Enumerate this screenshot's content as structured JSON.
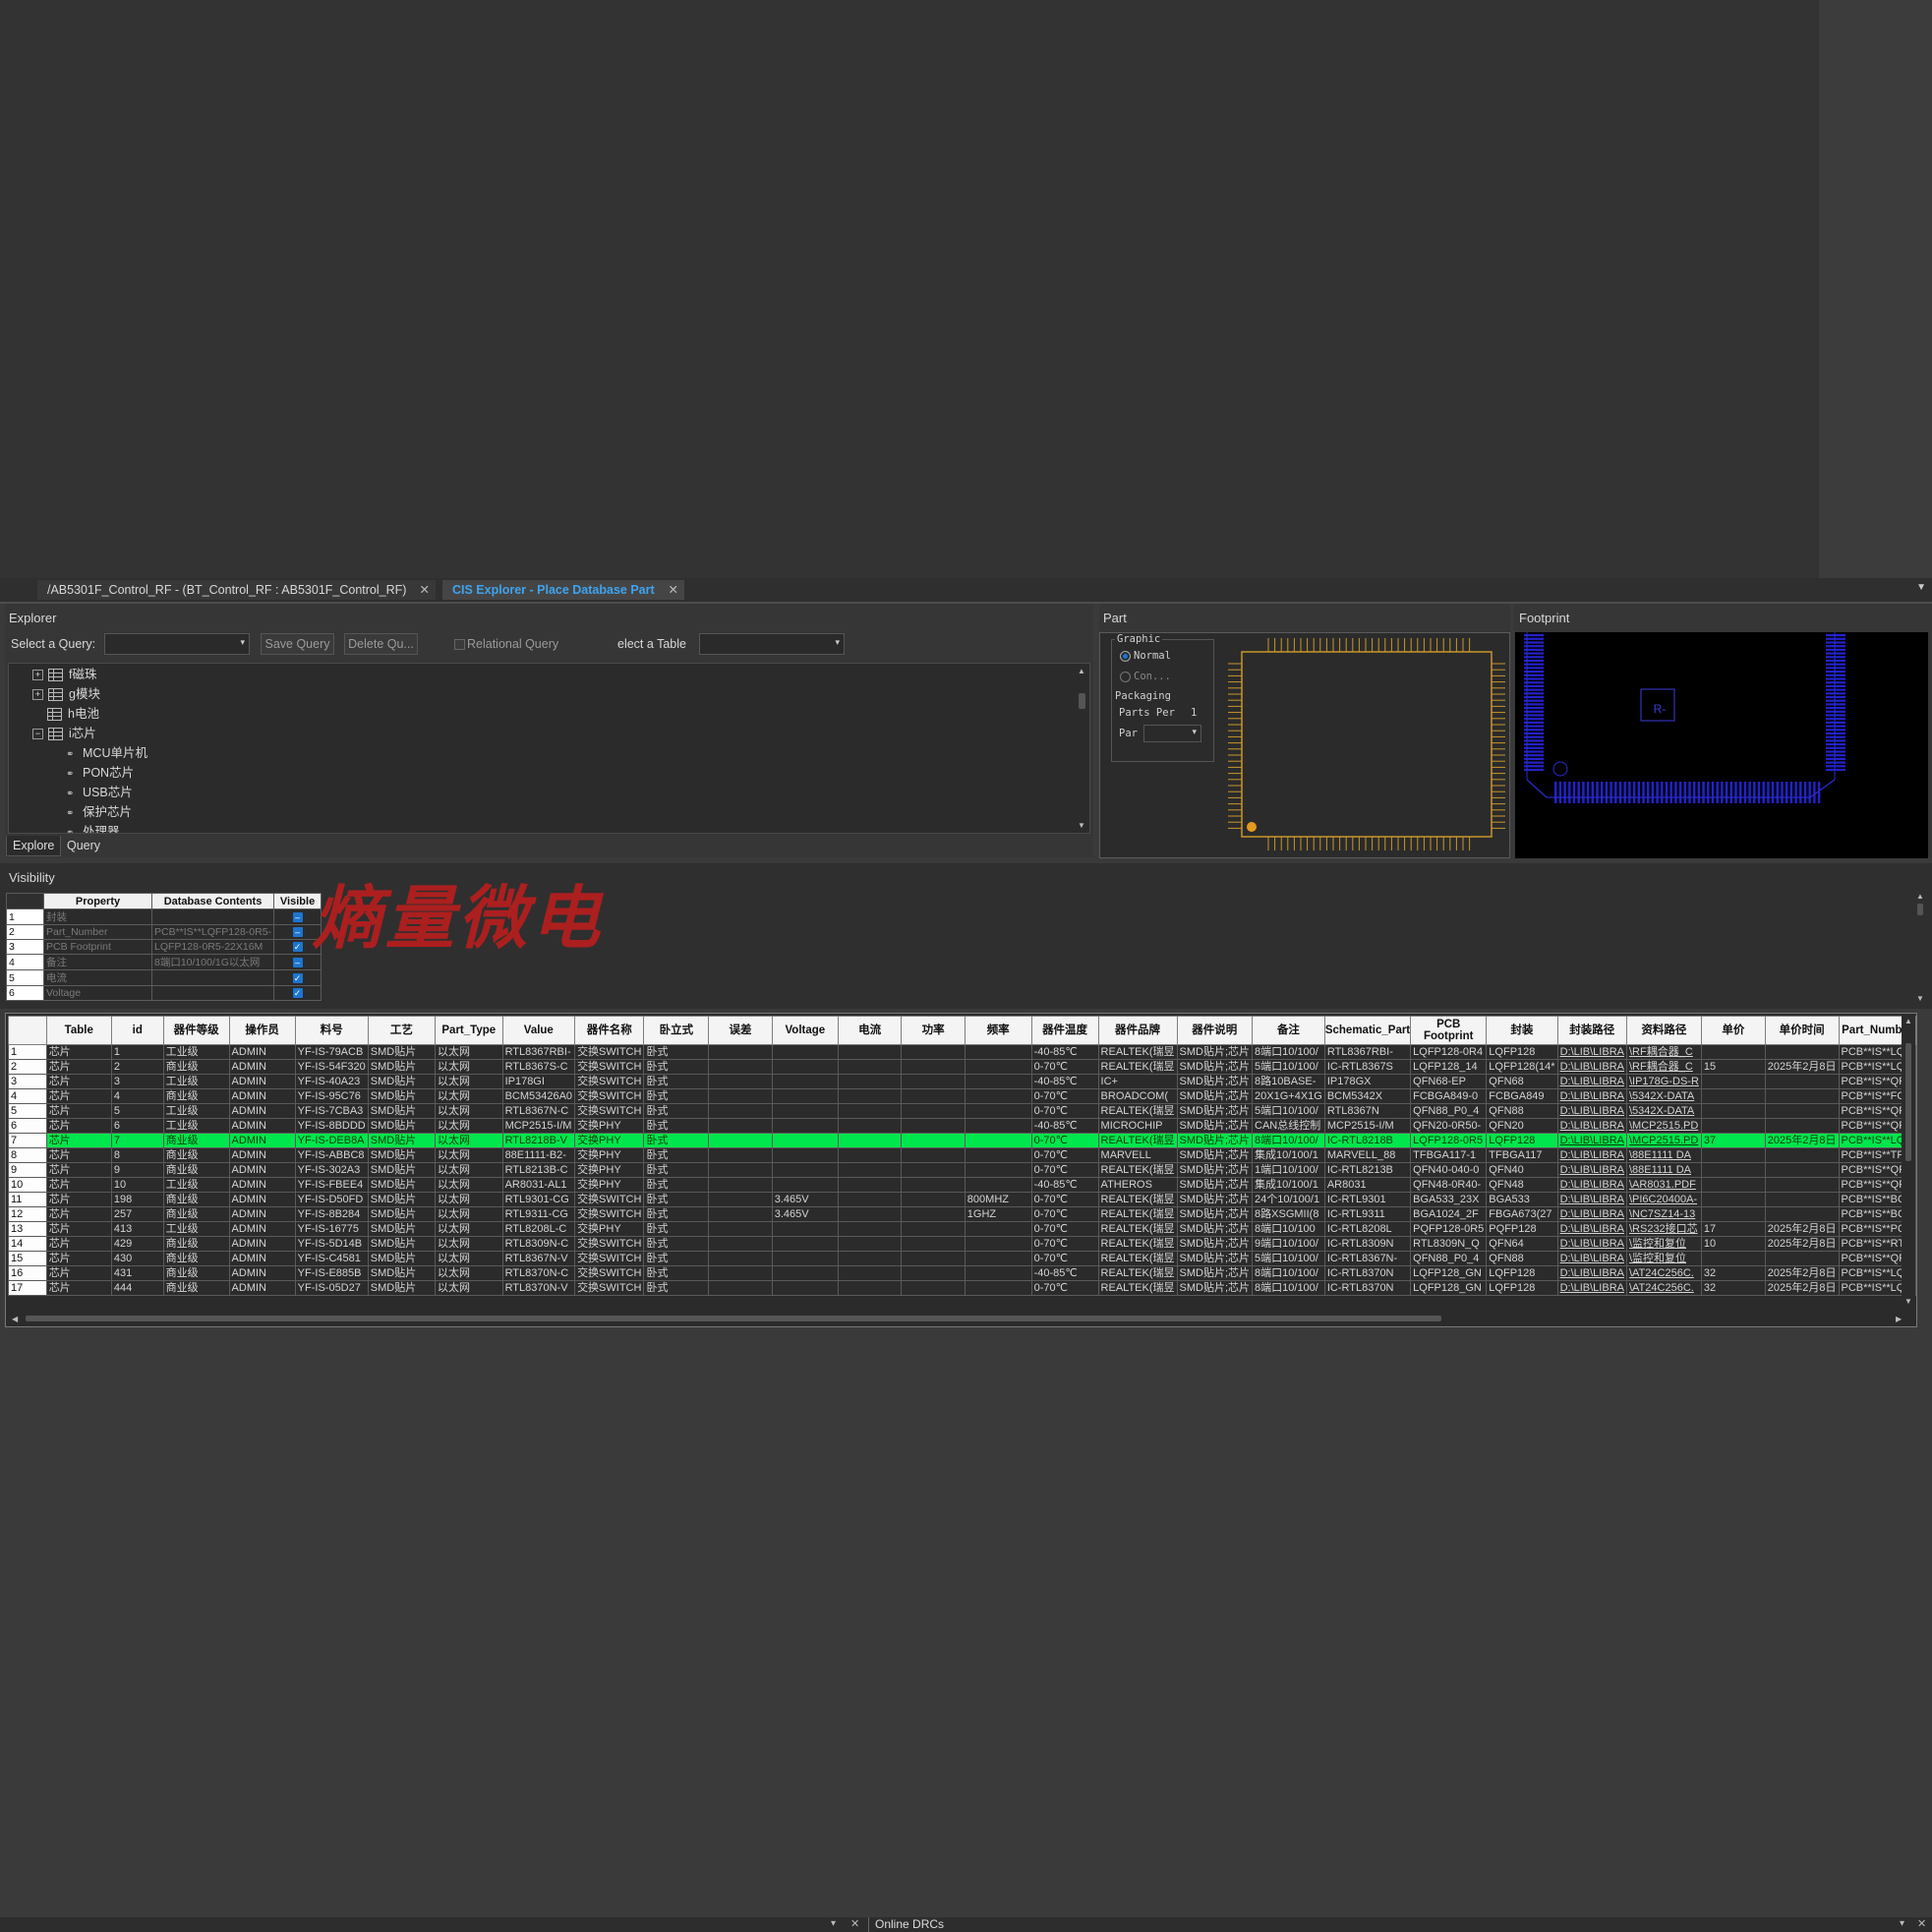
{
  "tabs": [
    {
      "label": "/AB5301F_Control_RF - (BT_Control_RF : AB5301F_Control_RF)",
      "close": "✕"
    },
    {
      "label": "CIS Explorer - Place Database Part",
      "close": "✕"
    }
  ],
  "explorer": {
    "title": "Explorer",
    "select_query_label": "Select a Query:",
    "save_query": "Save Query",
    "delete_query": "Delete Qu...",
    "relational_query": "Relational Query",
    "select_table_label": "elect a Table",
    "tree": [
      {
        "label": "f磁珠",
        "expander": "+"
      },
      {
        "label": "g模块",
        "expander": "+"
      },
      {
        "label": "h电池",
        "expander": ""
      },
      {
        "label": "i芯片",
        "expander": "−"
      },
      {
        "label": "MCU单片机"
      },
      {
        "label": "PON芯片"
      },
      {
        "label": "USB芯片"
      },
      {
        "label": "保护芯片"
      },
      {
        "label": "处理器"
      }
    ],
    "subtabs": [
      "Explore",
      "Query"
    ]
  },
  "part": {
    "title": "Part",
    "graphic_label": "Graphic",
    "normal_label": "Normal",
    "convert_label": "Con...",
    "packaging_label": "Packaging",
    "parts_per_label": "Parts Per",
    "parts_per_value": "1",
    "part_label": "Par",
    "pin1_color": "#e39a1e",
    "body_color": "#c9962a"
  },
  "footprint": {
    "title": "Footprint",
    "refdes": "R-",
    "pad_color": "#2222cc"
  },
  "visibility": {
    "title": "Visibility",
    "headers": [
      "Property",
      "Database Contents",
      "Visible"
    ],
    "rows": [
      {
        "n": "1",
        "property": "封装",
        "contents": "",
        "visible": false
      },
      {
        "n": "2",
        "property": "Part_Number",
        "contents": "PCB**IS**LQFP128-0R5-",
        "visible": false
      },
      {
        "n": "3",
        "property": "PCB Footprint",
        "contents": "LQFP128-0R5-22X16M",
        "visible": true
      },
      {
        "n": "4",
        "property": "备注",
        "contents": "8端口10/100/1G以太网",
        "visible": false
      },
      {
        "n": "5",
        "property": "电流",
        "contents": "",
        "visible": true
      },
      {
        "n": "6",
        "property": "Voltage",
        "contents": "",
        "visible": true
      }
    ],
    "watermark": "熵量微电"
  },
  "grid": {
    "headers": [
      "Table",
      "id",
      "器件等级",
      "操作员",
      "料号",
      "工艺",
      "Part_Type",
      "Value",
      "器件名称",
      "卧立式",
      "误差",
      "Voltage",
      "电流",
      "功率",
      "频率",
      "器件温度",
      "器件品牌",
      "器件说明",
      "备注",
      "Schematic_Part",
      "PCB Footprint",
      "封装",
      "封装路径",
      "资料路径",
      "单价",
      "单价时间",
      "Part_Number"
    ],
    "selected_row": "7",
    "rows": [
      [
        "1",
        "芯片",
        "1",
        "工业级",
        "ADMIN",
        "YF-IS-79ACB",
        "SMD贴片",
        "以太网",
        "RTL8367RBI-",
        "交换SWITCH",
        "卧式",
        "",
        "",
        "",
        "",
        "",
        "-40-85℃",
        "REALTEK(瑞昱",
        "SMD贴片;芯片",
        "8端口10/100/",
        "RTL8367RBI-",
        "LQFP128-0R4",
        "LQFP128",
        "D:\\LIB\\LIBRA",
        "\\RF耦合器_C",
        "",
        "",
        "PCB**IS**LQF"
      ],
      [
        "2",
        "芯片",
        "2",
        "商业级",
        "ADMIN",
        "YF-IS-54F320",
        "SMD贴片",
        "以太网",
        "RTL8367S-C",
        "交换SWITCH",
        "卧式",
        "",
        "",
        "",
        "",
        "",
        "0-70℃",
        "REALTEK(瑞昱",
        "SMD贴片;芯片",
        "5端口10/100/",
        "IC-RTL8367S",
        "LQFP128_14",
        "LQFP128(14*",
        "D:\\LIB\\LIBRA",
        "\\RF耦合器_C",
        "15",
        "2025年2月8日",
        "PCB**IS**LQF"
      ],
      [
        "3",
        "芯片",
        "3",
        "工业级",
        "ADMIN",
        "YF-IS-40A23",
        "SMD贴片",
        "以太网",
        "IP178GI",
        "交换SWITCH",
        "卧式",
        "",
        "",
        "",
        "",
        "",
        "-40-85℃",
        "IC+",
        "SMD贴片;芯片",
        "8路10BASE-",
        "IP178GX",
        "QFN68-EP",
        "QFN68",
        "D:\\LIB\\LIBRA",
        "\\IP178G-DS-R",
        "",
        "",
        "PCB**IS**QFN"
      ],
      [
        "4",
        "芯片",
        "4",
        "商业级",
        "ADMIN",
        "YF-IS-95C76",
        "SMD贴片",
        "以太网",
        "BCM53426A0",
        "交换SWITCH",
        "卧式",
        "",
        "",
        "",
        "",
        "",
        "0-70℃",
        "BROADCOM(",
        "SMD贴片;芯片",
        "20X1G+4X1G",
        "BCM5342X",
        "FCBGA849-0",
        "FCBGA849",
        "D:\\LIB\\LIBRA",
        "\\5342X-DATA",
        "",
        "",
        "PCB**IS**FCB"
      ],
      [
        "5",
        "芯片",
        "5",
        "工业级",
        "ADMIN",
        "YF-IS-7CBA3",
        "SMD贴片",
        "以太网",
        "RTL8367N-C",
        "交换SWITCH",
        "卧式",
        "",
        "",
        "",
        "",
        "",
        "0-70℃",
        "REALTEK(瑞昱",
        "SMD贴片;芯片",
        "5端口10/100/",
        "RTL8367N",
        "QFN88_P0_4",
        "QFN88",
        "D:\\LIB\\LIBRA",
        "\\5342X-DATA",
        "",
        "",
        "PCB**IS**QFN"
      ],
      [
        "6",
        "芯片",
        "6",
        "工业级",
        "ADMIN",
        "YF-IS-8BDDD",
        "SMD贴片",
        "以太网",
        "MCP2515-I/M",
        "交换PHY",
        "卧式",
        "",
        "",
        "",
        "",
        "",
        "-40-85℃",
        "MICROCHIP",
        "SMD贴片;芯片",
        "CAN总线控制",
        "MCP2515-I/M",
        "QFN20-0R50-",
        "QFN20",
        "D:\\LIB\\LIBRA",
        "\\MCP2515.PD",
        "",
        "",
        "PCB**IS**QFN"
      ],
      [
        "7",
        "芯片",
        "7",
        "商业级",
        "ADMIN",
        "YF-IS-DEB8A",
        "SMD贴片",
        "以太网",
        "RTL8218B-V",
        "交换PHY",
        "卧式",
        "",
        "",
        "",
        "",
        "",
        "0-70℃",
        "REALTEK(瑞昱",
        "SMD贴片;芯片",
        "8端口10/100/",
        "IC-RTL8218B",
        "LQFP128-0R5",
        "LQFP128",
        "D:\\LIB\\LIBRA",
        "\\MCP2515.PD",
        "37",
        "2025年2月8日",
        "PCB**IS**LQF"
      ],
      [
        "8",
        "芯片",
        "8",
        "商业级",
        "ADMIN",
        "YF-IS-ABBC8",
        "SMD贴片",
        "以太网",
        "88E1111-B2-",
        "交换PHY",
        "卧式",
        "",
        "",
        "",
        "",
        "",
        "0-70℃",
        "MARVELL",
        "SMD贴片;芯片",
        "集成10/100/1",
        "MARVELL_88",
        "TFBGA117-1",
        "TFBGA117",
        "D:\\LIB\\LIBRA",
        "\\88E1111 DA",
        "",
        "",
        "PCB**IS**TFB"
      ],
      [
        "9",
        "芯片",
        "9",
        "商业级",
        "ADMIN",
        "YF-IS-302A3",
        "SMD贴片",
        "以太网",
        "RTL8213B-C",
        "交换PHY",
        "卧式",
        "",
        "",
        "",
        "",
        "",
        "0-70℃",
        "REALTEK(瑞昱",
        "SMD贴片;芯片",
        "1端口10/100/",
        "IC-RTL8213B",
        "QFN40-040-0",
        "QFN40",
        "D:\\LIB\\LIBRA",
        "\\88E1111 DA",
        "",
        "",
        "PCB**IS**QFN"
      ],
      [
        "10",
        "芯片",
        "10",
        "工业级",
        "ADMIN",
        "YF-IS-FBEE4",
        "SMD贴片",
        "以太网",
        "AR8031-AL1",
        "交换PHY",
        "卧式",
        "",
        "",
        "",
        "",
        "",
        "-40-85℃",
        "ATHEROS",
        "SMD贴片;芯片",
        "集成10/100/1",
        "AR8031",
        "QFN48-0R40-",
        "QFN48",
        "D:\\LIB\\LIBRA",
        "\\AR8031.PDF",
        "",
        "",
        "PCB**IS**QFN"
      ],
      [
        "11",
        "芯片",
        "198",
        "商业级",
        "ADMIN",
        "YF-IS-D50FD",
        "SMD贴片",
        "以太网",
        "RTL9301-CG",
        "交换SWITCH",
        "卧式",
        "",
        "3.465V",
        "",
        "",
        "800MHZ",
        "0-70℃",
        "REALTEK(瑞昱",
        "SMD贴片;芯片",
        "24个10/100/1",
        "IC-RTL9301",
        "BGA533_23X",
        "BGA533",
        "D:\\LIB\\LIBRA",
        "\\PI6C20400A-",
        "",
        "",
        "PCB**IS**BG"
      ],
      [
        "12",
        "芯片",
        "257",
        "商业级",
        "ADMIN",
        "YF-IS-8B284",
        "SMD贴片",
        "以太网",
        "RTL9311-CG",
        "交换SWITCH",
        "卧式",
        "",
        "3.465V",
        "",
        "",
        "1GHZ",
        "0-70℃",
        "REALTEK(瑞昱",
        "SMD贴片;芯片",
        "8路XSGMII(8",
        "IC-RTL9311",
        "BGA1024_2F",
        "FBGA673(27",
        "D:\\LIB\\LIBRA",
        "\\NC7SZ14-13",
        "",
        "",
        "PCB**IS**BG"
      ],
      [
        "13",
        "芯片",
        "413",
        "工业级",
        "ADMIN",
        "YF-IS-16775",
        "SMD贴片",
        "以太网",
        "RTL8208L-C",
        "交换PHY",
        "卧式",
        "",
        "",
        "",
        "",
        "",
        "0-70℃",
        "REALTEK(瑞昱",
        "SMD贴片;芯片",
        "8端口10/100",
        "IC-RTL8208L",
        "PQFP128-0R5",
        "PQFP128",
        "D:\\LIB\\LIBRA",
        "\\RS232接口芯",
        "17",
        "2025年2月8日",
        "PCB**IS**PQF"
      ],
      [
        "14",
        "芯片",
        "429",
        "商业级",
        "ADMIN",
        "YF-IS-5D14B",
        "SMD贴片",
        "以太网",
        "RTL8309N-C",
        "交换SWITCH",
        "卧式",
        "",
        "",
        "",
        "",
        "",
        "0-70℃",
        "REALTEK(瑞昱",
        "SMD贴片;芯片",
        "9端口10/100/",
        "IC-RTL8309N",
        "RTL8309N_Q",
        "QFN64",
        "D:\\LIB\\LIBRA",
        "\\监控和复位",
        "10",
        "2025年2月8日",
        "PCB**IS**RTL"
      ],
      [
        "15",
        "芯片",
        "430",
        "商业级",
        "ADMIN",
        "YF-IS-C4581",
        "SMD贴片",
        "以太网",
        "RTL8367N-V",
        "交换SWITCH",
        "卧式",
        "",
        "",
        "",
        "",
        "",
        "0-70℃",
        "REALTEK(瑞昱",
        "SMD贴片;芯片",
        "5端口10/100/",
        "IC-RTL8367N-",
        "QFN88_P0_4",
        "QFN88",
        "D:\\LIB\\LIBRA",
        "\\监控和复位",
        "",
        "",
        "PCB**IS**QFN"
      ],
      [
        "16",
        "芯片",
        "431",
        "商业级",
        "ADMIN",
        "YF-IS-E885B",
        "SMD贴片",
        "以太网",
        "RTL8370N-C",
        "交换SWITCH",
        "卧式",
        "",
        "",
        "",
        "",
        "",
        "-40-85℃",
        "REALTEK(瑞昱",
        "SMD贴片;芯片",
        "8端口10/100/",
        "IC-RTL8370N",
        "LQFP128_GN",
        "LQFP128",
        "D:\\LIB\\LIBRA",
        "\\AT24C256C.",
        "32",
        "2025年2月8日",
        "PCB**IS**LQF"
      ],
      [
        "17",
        "芯片",
        "444",
        "商业级",
        "ADMIN",
        "YF-IS-05D27",
        "SMD贴片",
        "以太网",
        "RTL8370N-V",
        "交换SWITCH",
        "卧式",
        "",
        "",
        "",
        "",
        "",
        "0-70℃",
        "REALTEK(瑞昱",
        "SMD贴片;芯片",
        "8端口10/100/",
        "IC-RTL8370N",
        "LQFP128_GN",
        "LQFP128",
        "D:\\LIB\\LIBRA",
        "\\AT24C256C.",
        "32",
        "2025年2月8日",
        "PCB**IS**LQF"
      ]
    ]
  },
  "statusbar": {
    "label": "Online DRCs",
    "close": "✕"
  }
}
